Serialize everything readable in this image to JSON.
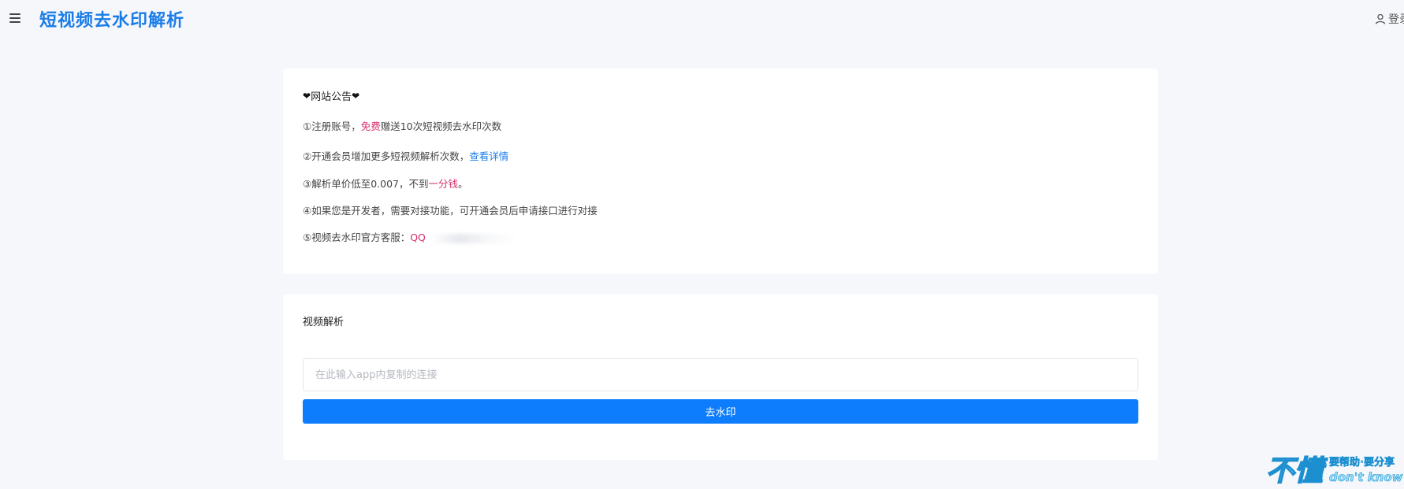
{
  "header": {
    "title": "短视频去水印解析",
    "login_label": "登录"
  },
  "notice": {
    "title": "网站公告",
    "line1": {
      "prefix": "①注册账号，",
      "highlight": "免费",
      "suffix": "赠送10次短视频去水印次数"
    },
    "line2": {
      "prefix": "②开通会员增加更多短视频解析次数，",
      "link": "查看详情"
    },
    "line3": {
      "prefix": "③解析单价低至0.007，不到",
      "highlight": "一分钱",
      "suffix": "。"
    },
    "line4": {
      "text": "④如果您是开发者，需要对接功能，可开通会员后申请接口进行对接"
    },
    "line5": {
      "prefix": "⑤视频去水印官方客服：",
      "highlight": "QQ"
    }
  },
  "parse": {
    "title": "视频解析",
    "input_placeholder": "在此输入app内复制的连接",
    "input_value": "",
    "button_label": "去水印"
  },
  "watermark": {
    "main": "不懂",
    "sub1": "要帮助·要分享",
    "sub2": "don't know"
  },
  "colors": {
    "accent": "#1a7ce8",
    "button": "#0d7dfd",
    "highlight": "#d6306f",
    "background": "#f5f7fb"
  },
  "icons": {
    "menu": "hamburger-menu-icon",
    "user": "user-icon",
    "heart": "heart-icon"
  }
}
